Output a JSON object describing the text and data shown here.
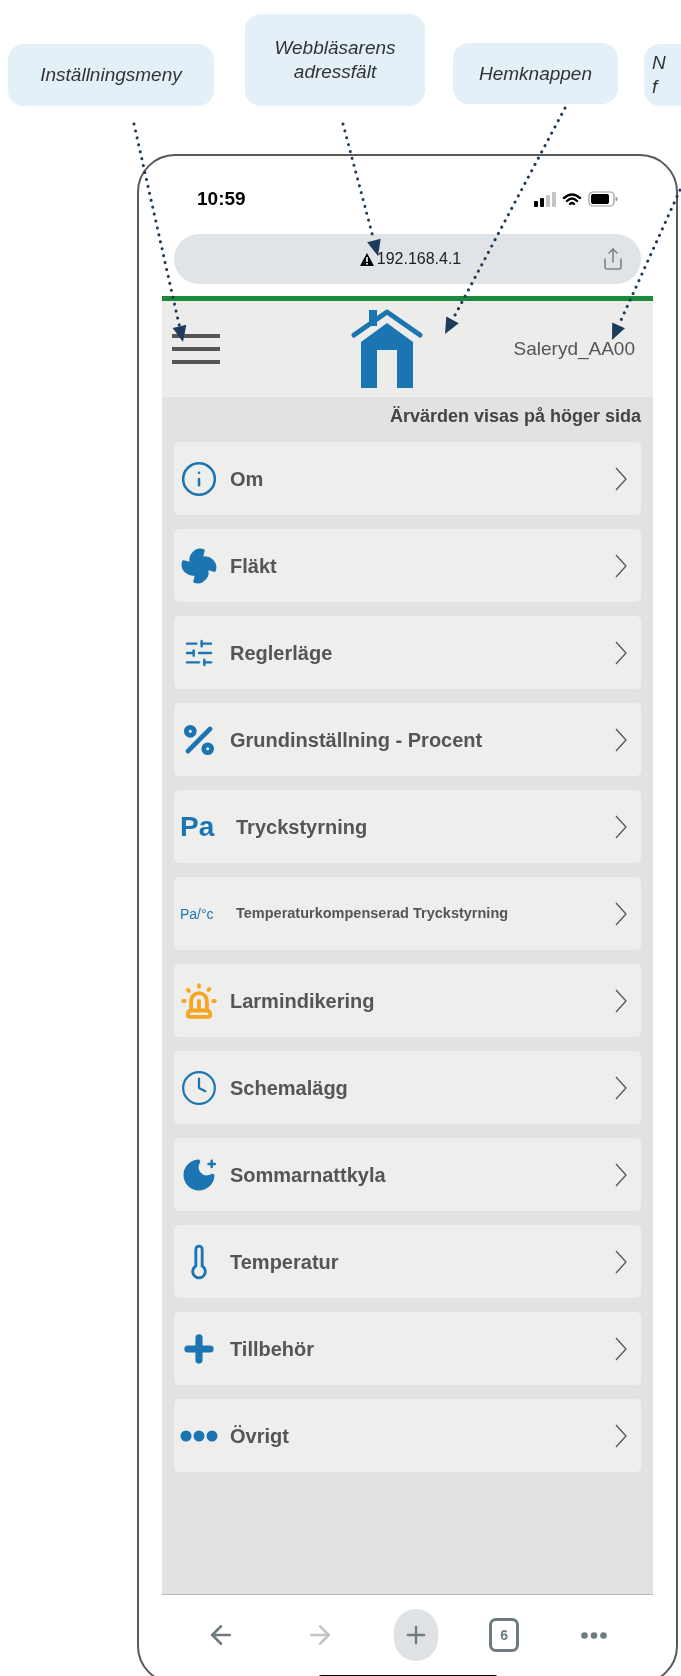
{
  "annotations": [
    {
      "lines": [
        "Inställningsmeny"
      ]
    },
    {
      "lines": [
        "Webbläsarens",
        "adressfält"
      ]
    },
    {
      "lines": [
        "Hemknappen"
      ]
    },
    {
      "lines": [
        "N",
        "f"
      ]
    }
  ],
  "status_bar": {
    "time": "10:59"
  },
  "address_bar": {
    "url": "192.168.4.1"
  },
  "header": {
    "device_name": "Saleryd_AA00"
  },
  "subtitle": "Ärvärden visas på höger sida",
  "menu_items": [
    {
      "label": "Om"
    },
    {
      "label": "Fläkt"
    },
    {
      "label": "Reglerläge"
    },
    {
      "label": "Grundinställning - Procent"
    },
    {
      "icon_text": "Pa",
      "label": "Tryckstyrning"
    },
    {
      "icon_text": "Pa/°c",
      "label": "Temperaturkompenserad Tryckstyrning"
    },
    {
      "label": "Larmindikering"
    },
    {
      "label": "Schemalägg"
    },
    {
      "label": "Sommarnattkyla"
    },
    {
      "label": "Temperatur"
    },
    {
      "label": "Tillbehör"
    },
    {
      "label": "Övrigt"
    }
  ],
  "toolbar": [
    {
      "kind": "back",
      "disabled": false
    },
    {
      "kind": "forward",
      "disabled": true
    },
    {
      "kind": "new_tab",
      "disabled": false
    },
    {
      "kind": "tabs",
      "count": "6",
      "disabled": false
    },
    {
      "kind": "more",
      "disabled": false
    }
  ]
}
